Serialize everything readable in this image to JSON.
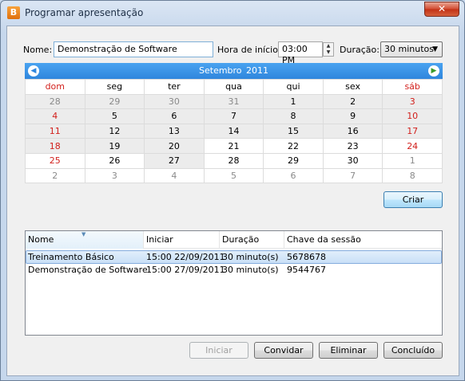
{
  "window": {
    "title": "Programar apresentação",
    "icon": "app-b-icon",
    "close_label": "✕"
  },
  "form": {
    "name_label": "Nome:",
    "name_value": "Demonstração de Software",
    "start_label": "Hora de início:",
    "start_value": "03:00 PM",
    "duration_label": "Duração:",
    "duration_value": "30 minutos"
  },
  "calendar": {
    "month": "Setembro",
    "year": "2011",
    "prev_icon": "chevron-left-icon",
    "next_icon": "chevron-right-icon",
    "weekdays": [
      "dom",
      "seg",
      "ter",
      "qua",
      "qui",
      "sex",
      "sáb"
    ],
    "weeks": [
      [
        "28",
        "29",
        "30",
        "31",
        "1",
        "2",
        "3"
      ],
      [
        "4",
        "5",
        "6",
        "7",
        "8",
        "9",
        "10"
      ],
      [
        "11",
        "12",
        "13",
        "14",
        "15",
        "16",
        "17"
      ],
      [
        "18",
        "19",
        "20",
        "21",
        "22",
        "23",
        "24"
      ],
      [
        "25",
        "26",
        "27",
        "28",
        "29",
        "30",
        "1"
      ],
      [
        "2",
        "3",
        "4",
        "5",
        "6",
        "7",
        "8"
      ]
    ]
  },
  "buttons": {
    "create": "Criar",
    "start": "Iniciar",
    "invite": "Convidar",
    "delete": "Eliminar",
    "done": "Concluído"
  },
  "list": {
    "columns": [
      "Nome",
      "Iniciar",
      "Duração",
      "Chave da sessão"
    ],
    "rows": [
      {
        "name": "Treinamento Básico",
        "start": "15:00 22/09/2011",
        "duration": "30 minuto(s)",
        "key": "5678678"
      },
      {
        "name": "Demonstração de Software",
        "start": "15:00 27/09/2011",
        "duration": "30 minuto(s)",
        "key": "9544767"
      }
    ]
  },
  "colors": {
    "calendar_header": "#2f86dd",
    "weekend_red": "#d2201c",
    "selection": "#c9e0f7"
  }
}
